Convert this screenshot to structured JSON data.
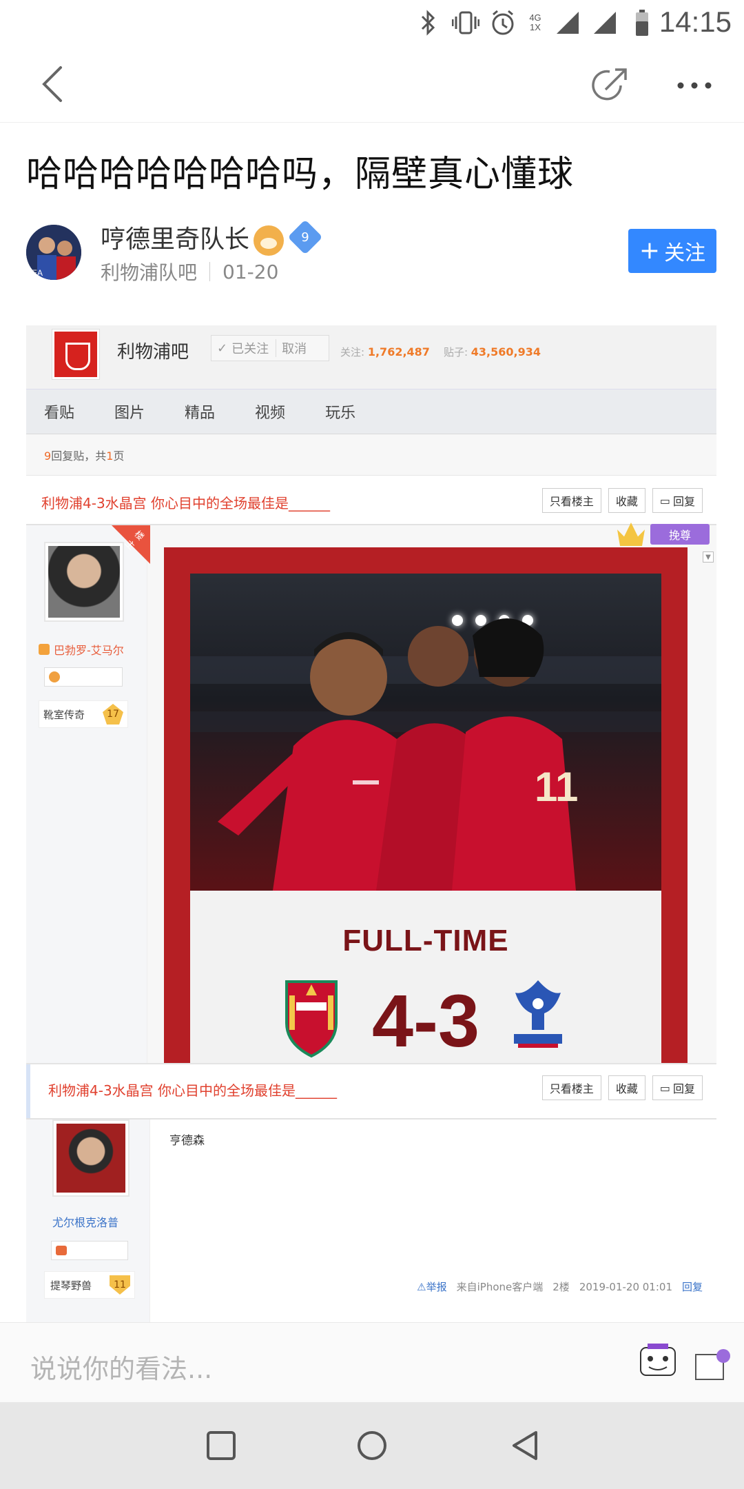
{
  "status_bar": {
    "time": "14:15",
    "network": "4G 1X",
    "icons": [
      "bluetooth-icon",
      "vibrate-icon",
      "alarm-icon",
      "signal-icon",
      "battery-icon"
    ]
  },
  "nav": {
    "back_icon": "chevron-left-icon",
    "share_icon": "share-icon",
    "more_icon": "more-icon"
  },
  "post": {
    "title": "哈哈哈哈哈哈哈吗，隔壁真心懂球",
    "author": "哼德里奇队长",
    "author_level": "9",
    "forum": "利物浦队吧",
    "date": "01-20",
    "follow_label": "关注"
  },
  "embedded_page": {
    "bar_name": "利物浦吧",
    "followed_label": "已关注",
    "cancel_label": "取消",
    "stats_follow_label": "关注:",
    "stats_follow_value": "1,762,487",
    "stats_posts_label": "贴子:",
    "stats_posts_value": "43,560,934",
    "tabs": [
      "看贴",
      "图片",
      "精品",
      "视频",
      "玩乐"
    ],
    "reply_count_n": "9",
    "reply_count_pages": "1",
    "reply_count_text_pre": "回复贴，共",
    "reply_count_text_post": "页",
    "thread_title": "利物浦4-3水晶宫 你心目中的全场最佳是______",
    "thread_buttons": [
      "只看楼主",
      "收藏",
      "回复"
    ],
    "louzhu_tag": "楼主",
    "change_tag": "挽尊",
    "poster_name": "巴勃罗-艾马尔",
    "poster_grade": "靴室传奇",
    "poster_level": "17",
    "photo": {
      "full_time_label": "FULL-TIME",
      "score": "4-3"
    },
    "second_post": {
      "thread_title": "利物浦4-3水晶宫 你心目中的全场最佳是______",
      "thread_buttons": [
        "只看楼主",
        "收藏",
        "回复"
      ],
      "poster_name": "尤尔根克洛普",
      "poster_grade": "提琴野兽",
      "poster_level": "11",
      "content": "亨德森",
      "report_label": "举报",
      "source": "来自iPhone客户端",
      "floor": "2楼",
      "datetime": "2019-01-20 01:01",
      "reply_label": "回复"
    }
  },
  "comment_bar": {
    "placeholder": "说说你的看法..."
  },
  "colors": {
    "accent": "#3388ff",
    "tieba_red": "#e0402e",
    "lfc_red": "#c8102e"
  }
}
